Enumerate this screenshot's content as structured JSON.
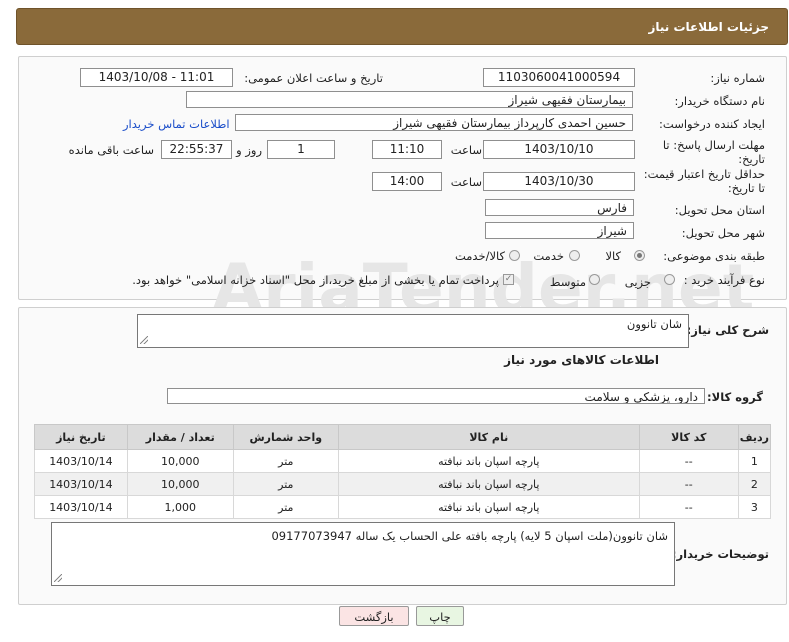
{
  "header": {
    "title": "جزئیات اطلاعات نیاز"
  },
  "labels": {
    "need_number": "شماره نیاز:",
    "announce_datetime": "تاریخ و ساعت اعلان عمومی:",
    "buyer_org": "نام دستگاه خریدار:",
    "requester": "ایجاد کننده درخواست:",
    "reply_deadline": "مهلت ارسال پاسخ: تا تاریخ:",
    "min_validity": "حداقل تاریخ اعتبار قیمت: تا تاریخ:",
    "time_word": "ساعت",
    "day_and": "روز و",
    "hours_left": "ساعت باقی مانده",
    "province": "استان محل تحویل:",
    "city": "شهر محل تحویل:",
    "category": "طبقه بندی موضوعی:",
    "process_type": "نوع فرآیند خرید :",
    "description": "شرح کلی نیاز:",
    "goods_info": "اطلاعات کالاهای مورد نیاز",
    "goods_group": "گروه کالا:",
    "buyer_notes": "توضیحات خریدار:"
  },
  "values": {
    "need_number": "1103060041000594",
    "announce_datetime": "1403/10/08 - 11:01",
    "buyer_org": "بیمارستان فقیهی شیراز",
    "requester": "حسین احمدی کارپرداز بیمارستان فقیهی شیراز",
    "contact_link": "اطلاعات تماس خریدار",
    "reply_date": "1403/10/10",
    "reply_time": "11:10",
    "days_left": "1",
    "time_left": "22:55:37",
    "validity_date": "1403/10/30",
    "validity_time": "14:00",
    "province": "فارس",
    "city": "شیراز",
    "description": "شان تانوون",
    "goods_group": "دارو، پزشکی و سلامت",
    "buyer_notes": "شان تانوون(ملت اسپان 5 لایه) پارچه بافته علی الحساب      یک ساله 09177073947"
  },
  "category_options": [
    "کالا",
    "خدمت",
    "کالا/خدمت"
  ],
  "category_selected": "کالا",
  "process_options": [
    "جزیی",
    "متوسط"
  ],
  "payment_note": "پرداخت تمام یا بخشی از مبلغ خرید،از محل \"اسناد خزانه اسلامی\" خواهد بود.",
  "table": {
    "headers": [
      "ردیف",
      "کد کالا",
      "نام کالا",
      "واحد شمارش",
      "تعداد / مقدار",
      "تاریخ نیاز"
    ],
    "rows": [
      [
        "1",
        "--",
        "پارچه اسپان باند نبافته",
        "متر",
        "10,000",
        "1403/10/14"
      ],
      [
        "2",
        "--",
        "پارچه اسپان باند نبافته",
        "متر",
        "10,000",
        "1403/10/14"
      ],
      [
        "3",
        "--",
        "پارچه اسپان باند نبافته",
        "متر",
        "1,000",
        "1403/10/14"
      ]
    ]
  },
  "buttons": {
    "print": "چاپ",
    "back": "بازگشت"
  },
  "watermark": "AriaTender.net"
}
